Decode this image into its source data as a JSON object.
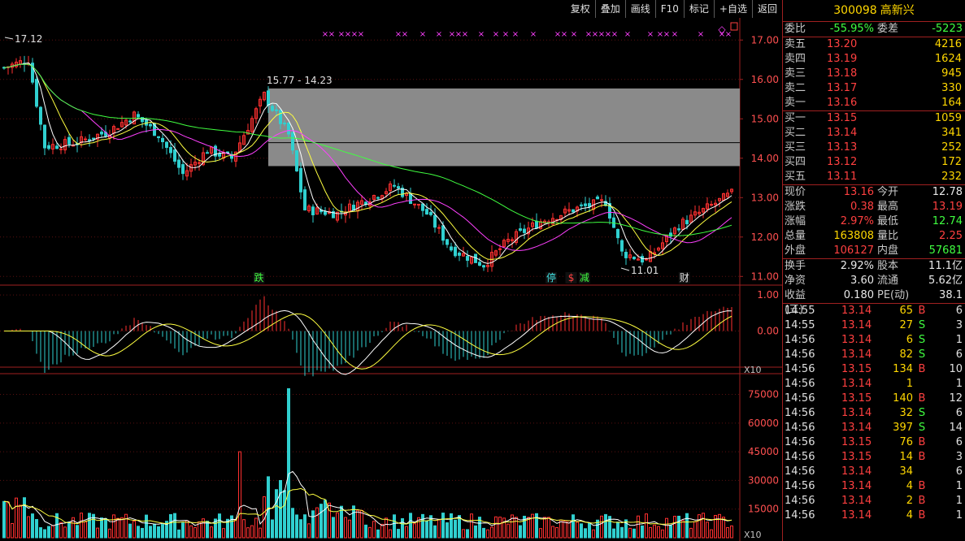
{
  "toolbar": [
    "复权",
    "叠加",
    "画线",
    "F10",
    "标记",
    "+自选",
    "返回"
  ],
  "stock": {
    "code": "300098",
    "name": "高新兴"
  },
  "ratio": {
    "label": "委比",
    "value": "-55.95%",
    "diff_label": "委差",
    "diff_value": "-5223"
  },
  "asks": [
    {
      "label": "卖五",
      "price": "13.20",
      "vol": "4216"
    },
    {
      "label": "卖四",
      "price": "13.19",
      "vol": "1624"
    },
    {
      "label": "卖三",
      "price": "13.18",
      "vol": "945"
    },
    {
      "label": "卖二",
      "price": "13.17",
      "vol": "330"
    },
    {
      "label": "卖一",
      "price": "13.16",
      "vol": "164"
    }
  ],
  "bids": [
    {
      "label": "买一",
      "price": "13.15",
      "vol": "1059"
    },
    {
      "label": "买二",
      "price": "13.14",
      "vol": "341"
    },
    {
      "label": "买三",
      "price": "13.13",
      "vol": "252"
    },
    {
      "label": "买四",
      "price": "13.12",
      "vol": "172"
    },
    {
      "label": "买五",
      "price": "13.11",
      "vol": "232"
    }
  ],
  "stats": [
    {
      "l1": "现价",
      "v1": "13.16",
      "c1": "red",
      "l2": "今开",
      "v2": "12.78",
      "c2": "white"
    },
    {
      "l1": "涨跌",
      "v1": "0.38",
      "c1": "red",
      "l2": "最高",
      "v2": "13.19",
      "c2": "red"
    },
    {
      "l1": "涨幅",
      "v1": "2.97%",
      "c1": "red",
      "l2": "最低",
      "v2": "12.74",
      "c2": "green"
    },
    {
      "l1": "总量",
      "v1": "163808",
      "c1": "yellow",
      "l2": "量比",
      "v2": "2.25",
      "c2": "red"
    },
    {
      "l1": "外盘",
      "v1": "106127",
      "c1": "red",
      "l2": "内盘",
      "v2": "57681",
      "c2": "green"
    }
  ],
  "stats2": [
    {
      "l1": "换手",
      "v1": "2.92%",
      "l2": "股本",
      "v2": "11.1亿"
    },
    {
      "l1": "净资",
      "v1": "3.60",
      "l2": "流通",
      "v2": "5.62亿"
    },
    {
      "l1": "收益(三)",
      "v1": "0.180",
      "l2": "PE(动)",
      "v2": "38.1"
    }
  ],
  "ticks": [
    {
      "t": "14:55",
      "p": "13.14",
      "v": "65",
      "s": "B",
      "n": "6"
    },
    {
      "t": "14:55",
      "p": "13.14",
      "v": "27",
      "s": "S",
      "n": "3"
    },
    {
      "t": "14:56",
      "p": "13.14",
      "v": "6",
      "s": "S",
      "n": "1"
    },
    {
      "t": "14:56",
      "p": "13.14",
      "v": "82",
      "s": "S",
      "n": "6"
    },
    {
      "t": "14:56",
      "p": "13.15",
      "v": "134",
      "s": "B",
      "n": "10"
    },
    {
      "t": "14:56",
      "p": "13.14",
      "v": "1",
      "s": "",
      "n": "1"
    },
    {
      "t": "14:56",
      "p": "13.15",
      "v": "140",
      "s": "B",
      "n": "12"
    },
    {
      "t": "14:56",
      "p": "13.14",
      "v": "32",
      "s": "S",
      "n": "6"
    },
    {
      "t": "14:56",
      "p": "13.14",
      "v": "397",
      "s": "S",
      "n": "14"
    },
    {
      "t": "14:56",
      "p": "13.15",
      "v": "76",
      "s": "B",
      "n": "6"
    },
    {
      "t": "14:56",
      "p": "13.15",
      "v": "14",
      "s": "B",
      "n": "3"
    },
    {
      "t": "14:56",
      "p": "13.14",
      "v": "34",
      "s": "",
      "n": "6"
    },
    {
      "t": "14:56",
      "p": "13.14",
      "v": "4",
      "s": "B",
      "n": "1"
    },
    {
      "t": "14:56",
      "p": "13.14",
      "v": "2",
      "s": "B",
      "n": "1"
    },
    {
      "t": "14:56",
      "p": "13.14",
      "v": "4",
      "s": "B",
      "n": "1"
    }
  ],
  "chart_data": {
    "type": "candlestick",
    "price_axis": {
      "ticks": [
        "17.00",
        "16.00",
        "15.00",
        "14.00",
        "13.00",
        "12.00",
        "11.00"
      ],
      "values": [
        17,
        16,
        15,
        14,
        13,
        12,
        11
      ]
    },
    "macd_axis": {
      "ticks": [
        "1.00",
        "0.00"
      ],
      "values": [
        1,
        0
      ]
    },
    "volume_axis": {
      "ticks": [
        "75000",
        "60000",
        "45000",
        "30000",
        "15000"
      ],
      "values": [
        75000,
        60000,
        45000,
        30000,
        15000
      ],
      "multiplier": "X10"
    },
    "annotations": {
      "high_label": "17.12",
      "high_value": 17.12,
      "range_label": "15.77 - 14.23",
      "range_high": 15.77,
      "range_low": 14.23,
      "low_label": "11.01",
      "low_value": 11.01
    },
    "markers": [
      {
        "text": "跌",
        "color": "#40ff40",
        "pos": 0.35
      },
      {
        "text": "停",
        "color": "#40e0e0",
        "pos": 0.745
      },
      {
        "text": "$",
        "color": "#ff4040",
        "pos": 0.772
      },
      {
        "text": "减",
        "color": "#40ff40",
        "pos": 0.79
      },
      {
        "text": "财",
        "color": "#e0e0e0",
        "pos": 0.925
      }
    ],
    "x_markers_text": "×"
  }
}
